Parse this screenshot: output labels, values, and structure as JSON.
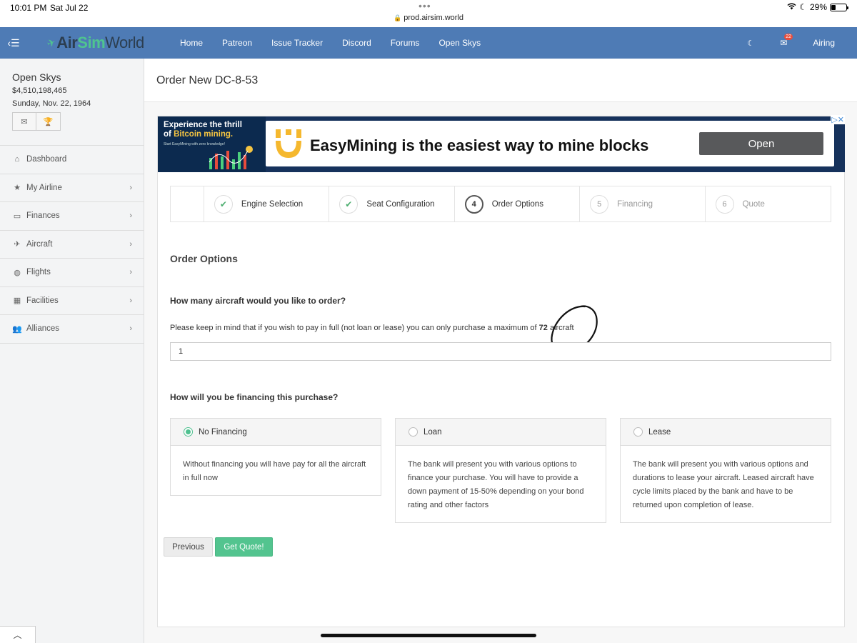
{
  "status_bar": {
    "time": "10:01 PM",
    "date": "Sat Jul 22",
    "url": "prod.airsim.world",
    "battery": "29%",
    "battery_level": 0.29
  },
  "navbar": {
    "logo": [
      "Air",
      "Sim",
      "World"
    ],
    "links": [
      "Home",
      "Patreon",
      "Issue Tracker",
      "Discord",
      "Forums",
      "Open Skys"
    ],
    "notification_count": "22",
    "user": "Airing",
    "color": "#4e7bb5"
  },
  "sidebar": {
    "airline_name": "Open Skys",
    "cash": "$4,510,198,465",
    "game_date": "Sunday, Nov. 22, 1964",
    "items": [
      {
        "label": "Dashboard",
        "icon": "home-icon",
        "has_children": false
      },
      {
        "label": "My Airline",
        "icon": "star-icon",
        "has_children": true
      },
      {
        "label": "Finances",
        "icon": "money-icon",
        "has_children": true
      },
      {
        "label": "Aircraft",
        "icon": "plane-icon",
        "has_children": true
      },
      {
        "label": "Flights",
        "icon": "globe-icon",
        "has_children": true
      },
      {
        "label": "Facilities",
        "icon": "building-icon",
        "has_children": true
      },
      {
        "label": "Alliances",
        "icon": "users-icon",
        "has_children": true
      }
    ]
  },
  "page": {
    "title": "Order New DC-8-53"
  },
  "ad": {
    "headline_1": "Experience the thrill",
    "headline_2a": "of ",
    "headline_2b": "Bitcoin mining.",
    "sub": "Start EasyMining with zero knowledge!",
    "text": "EasyMining is the easiest way to mine blocks",
    "button": "Open"
  },
  "steps": [
    {
      "num": "",
      "label": "Engine Selection",
      "state": "done"
    },
    {
      "num": "",
      "label": "Seat Configuration",
      "state": "done"
    },
    {
      "num": "4",
      "label": "Order Options",
      "state": "active"
    },
    {
      "num": "5",
      "label": "Financing",
      "state": "pending"
    },
    {
      "num": "6",
      "label": "Quote",
      "state": "pending"
    }
  ],
  "order": {
    "section_title": "Order Options",
    "quantity_question": "How many aircraft would you like to order?",
    "note_before": "Please keep in mind that if you wish to pay in full (not loan or lease) you can only purchase a maximum of ",
    "max_aircraft": "72",
    "note_after": " aircraft",
    "quantity_value": "1",
    "financing_question": "How will you be financing this purchase?"
  },
  "financing_options": [
    {
      "label": "No Financing",
      "selected": true,
      "description": "Without financing you will have pay for all the aircraft in full now"
    },
    {
      "label": "Loan",
      "selected": false,
      "description": "The bank will present you with various options to finance your purchase. You will have to provide a down payment of 15-50% depending on your bond rating and other factors"
    },
    {
      "label": "Lease",
      "selected": false,
      "description": "The bank will present you with various options and durations to lease your aircraft. Leased aircraft have cycle limits placed by the bank and have to be returned upon completion of lease."
    }
  ],
  "buttons": {
    "previous": "Previous",
    "get_quote": "Get Quote!"
  }
}
